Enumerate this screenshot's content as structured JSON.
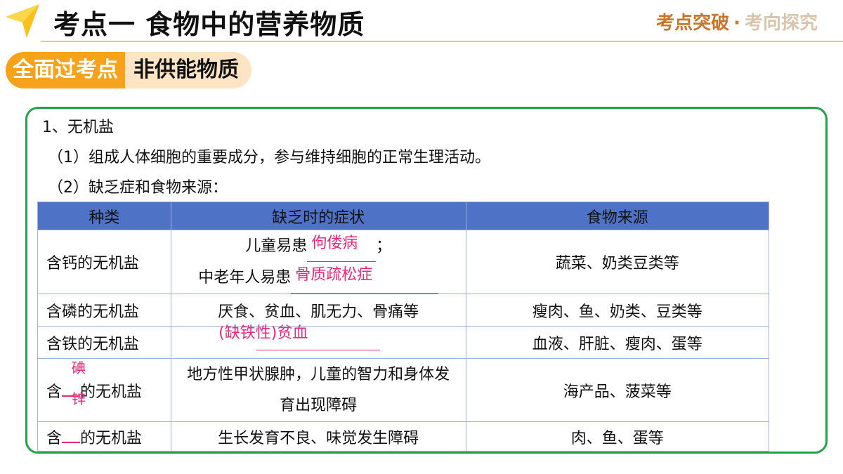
{
  "header": {
    "title": "考点一  食物中的营养物质",
    "right_primary": "考点突破",
    "right_sep": "·",
    "right_secondary": "考向探究"
  },
  "tag": {
    "left": "全面过考点",
    "right": "非供能物质"
  },
  "content": {
    "line1": "1、无机盐",
    "line2": "（1）组成人体细胞的重要成分，参与维持细胞的正常生理活动。",
    "line3": "（2）缺乏症和食物来源："
  },
  "table": {
    "headers": [
      "种类",
      "缺乏时的症状",
      "食物来源"
    ],
    "row1": {
      "kind": "含钙的无机盐",
      "symptom_a": "儿童易患",
      "answer_a": "佝偻病",
      "symptom_a_end": "；",
      "symptom_b": "中老年人易患",
      "answer_b": "骨质疏松症",
      "source": "蔬菜、奶类豆类等"
    },
    "row2": {
      "kind": "含磷的无机盐",
      "symptom": "厌食、贫血、肌无力、骨痛等",
      "source": "瘦肉、鱼、奶类、豆类等"
    },
    "row3": {
      "kind": "含铁的无机盐",
      "answer": "(缺铁性)贫血",
      "source": "血液、肝脏、瘦肉、蛋等"
    },
    "row4": {
      "kind_prefix": "含",
      "kind_suffix": "的无机盐",
      "answer_top": "碘",
      "answer_bottom": "锌",
      "symptom": "地方性甲状腺肿，儿童的智力和身体发育出现障碍",
      "source": "海产品、菠菜等"
    },
    "row5": {
      "kind_prefix": "含",
      "kind_suffix": "的无机盐",
      "symptom": "生长发育不良、味觉发生障碍",
      "source": "肉、鱼、蛋等"
    }
  },
  "colors": {
    "accent_orange": "#f7a21b",
    "border_green": "#22a34a",
    "table_header": "#4e72c5",
    "answer_pink": "#e8297a"
  }
}
